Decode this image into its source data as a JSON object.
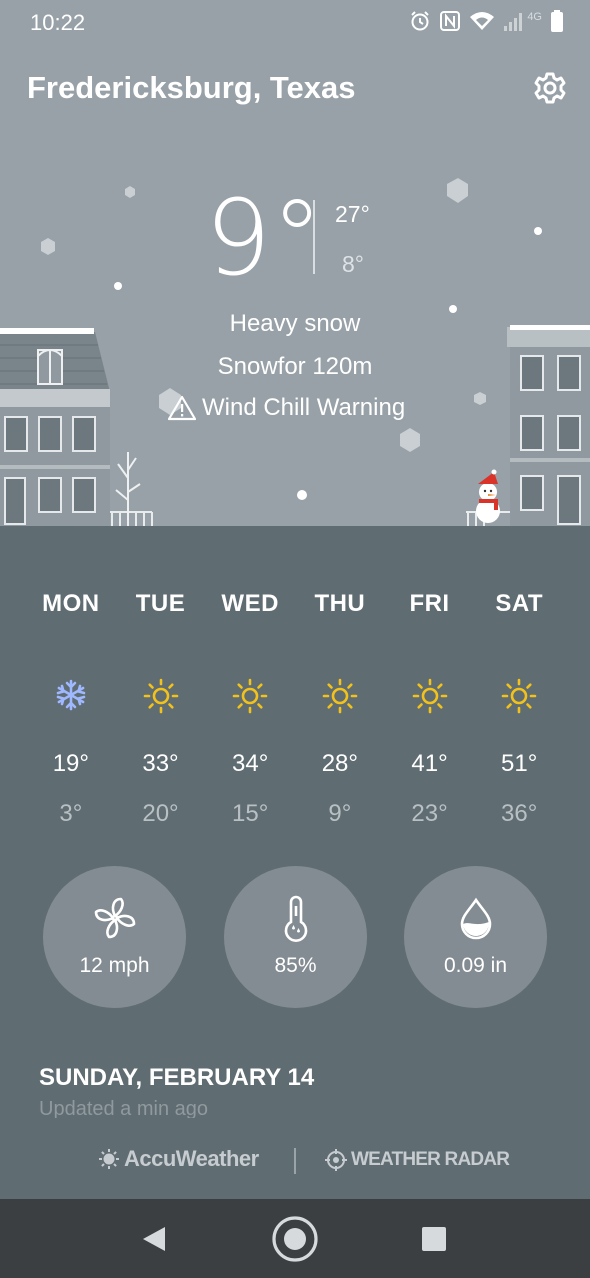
{
  "status_bar": {
    "time": "10:22",
    "network_label": "4G",
    "icons": [
      "alarm-icon",
      "nfc-icon",
      "wifi-icon",
      "signal-icon",
      "battery-icon"
    ]
  },
  "location": "Fredericksburg, Texas",
  "current": {
    "temp": "9°",
    "high": "27°",
    "low": "8°",
    "condition": "Heavy snow",
    "detail": "Snowfor 120m",
    "warning": "Wind Chill Warning"
  },
  "forecast": [
    {
      "day": "MON",
      "icon": "snowflake-icon",
      "high": "19°",
      "low": "3°"
    },
    {
      "day": "TUE",
      "icon": "sun-icon",
      "high": "33°",
      "low": "20°"
    },
    {
      "day": "WED",
      "icon": "sun-icon",
      "high": "34°",
      "low": "15°"
    },
    {
      "day": "THU",
      "icon": "sun-icon",
      "high": "28°",
      "low": "9°"
    },
    {
      "day": "FRI",
      "icon": "sun-icon",
      "high": "41°",
      "low": "23°"
    },
    {
      "day": "SAT",
      "icon": "sun-icon",
      "high": "51°",
      "low": "36°"
    }
  ],
  "metrics": {
    "wind": "12 mph",
    "humidity": "85%",
    "precipitation": "0.09 in"
  },
  "date": "SUNDAY, FEBRUARY 14",
  "updated": "Updated a min ago",
  "brands": {
    "accuweather": "AccuWeather",
    "weather_radar": "WEATHER RADAR"
  },
  "colors": {
    "hero_bg": "#97a1a7",
    "panel_bg": "#5f6c72",
    "circle_bg": "#838c92",
    "sun": "#f2c21b",
    "snowflake": "#9fb8ff",
    "navbar": "#3b3f42"
  }
}
